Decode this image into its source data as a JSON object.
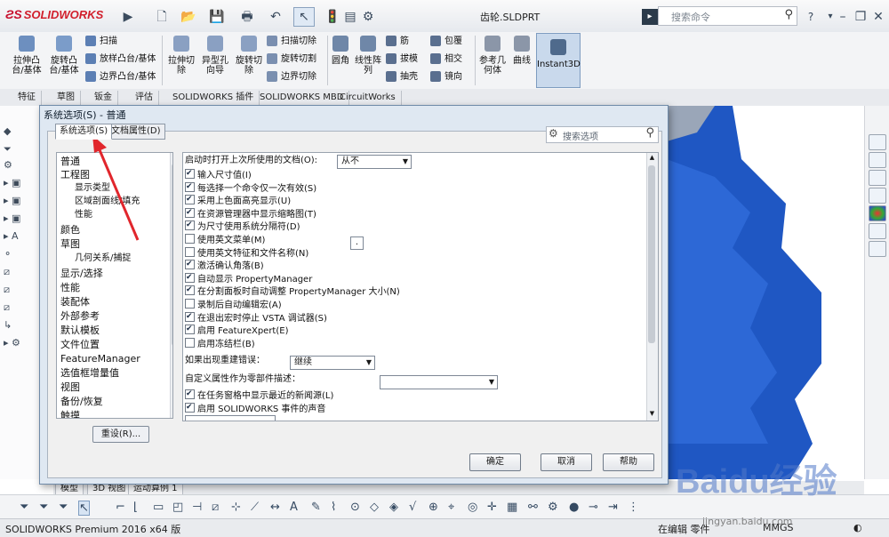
{
  "app": {
    "brand": "SOLIDWORKS",
    "file_title": "齿轮.SLDPRT",
    "search_placeholder": "搜索命令",
    "help_label": "?"
  },
  "ribbon": {
    "large": [
      "拉伸凸台/基体",
      "旋转凸台/基体",
      "拉伸切除",
      "异型孔向导",
      "旋转切除",
      "圆角",
      "线性阵列",
      "参考几何体",
      "曲线",
      "Instant3D"
    ],
    "small": [
      "扫描",
      "放样凸台/基体",
      "边界凸台/基体",
      "扫描切除",
      "旋转切割",
      "边界切除",
      "筋",
      "拔模",
      "抽壳",
      "包覆",
      "相交",
      "镜向"
    ]
  },
  "tabs": [
    "特征",
    "草图",
    "钣金",
    "评估",
    "SOLIDWORKS 插件",
    "SOLIDWORKS MBD",
    "CircuitWorks"
  ],
  "dialog": {
    "title": "系统选项(S) - 普通",
    "tab_system": "系统选项(S)",
    "tab_doc": "文档属性(D)",
    "search_placeholder": "搜索选项",
    "nav": [
      "普通",
      "工程图",
      "显示类型",
      "区域剖面线/填充",
      "性能",
      "颜色",
      "草图",
      "几何关系/捕捉",
      "显示/选择",
      "性能",
      "装配体",
      "外部参考",
      "默认模板",
      "文件位置",
      "FeatureManager",
      "选值框增量值",
      "视图",
      "备份/恢复",
      "触摸"
    ],
    "reset": "重设(R)...",
    "open_last_label": "启动时打开上次所使用的文档(O):",
    "open_last_value": "从不",
    "options": [
      {
        "label": "输入尺寸值(I)",
        "checked": true
      },
      {
        "label": "每选择一个命令仅一次有效(S)",
        "checked": true
      },
      {
        "label": "采用上色面高亮显示(U)",
        "checked": true
      },
      {
        "label": "在资源管理器中显示缩略图(T)",
        "checked": true
      },
      {
        "label": "为尺寸使用系统分隔符(D)",
        "checked": true
      },
      {
        "label": "使用英文菜单(M)",
        "checked": false
      },
      {
        "label": "使用英文特征和文件名称(N)",
        "checked": false
      },
      {
        "label": "激活确认角落(B)",
        "checked": true
      },
      {
        "label": "自动显示 PropertyManager",
        "checked": true
      },
      {
        "label": "在分割面板时自动调整 PropertyManager 大小(N)",
        "checked": true
      },
      {
        "label": "录制后自动编辑宏(A)",
        "checked": false
      },
      {
        "label": "在退出宏时停止 VSTA 调试器(S)",
        "checked": true
      },
      {
        "label": "启用 FeatureXpert(E)",
        "checked": true
      },
      {
        "label": "启用冻结栏(B)",
        "checked": false
      }
    ],
    "separator_value": ".",
    "rebuild_error_label": "如果出现重建错误：",
    "rebuild_error_value": "继续",
    "custom_prop_label": "自定义属性作为零部件描述：",
    "custom_prop_value": "",
    "options2": [
      {
        "label": "在任务窗格中显示最近的新闻源(L)",
        "checked": true
      },
      {
        "label": "启用 SOLIDWORKS 事件的声音",
        "checked": true
      }
    ],
    "ok": "确定",
    "cancel": "取消",
    "help": "帮助"
  },
  "bottom_tabs": [
    "模型",
    "3D 视图",
    "运动算例 1"
  ],
  "status": {
    "product": "SOLIDWORKS Premium 2016 x64 版",
    "mode": "在编辑 零件",
    "units": "MMGS"
  },
  "watermark": {
    "main": "Baidu经验",
    "sub": "jingyan.baidu.com"
  },
  "colors": {
    "accent": "#1f57c3",
    "dialog_bg": "#dfe8f2",
    "brand_red": "#c8102e",
    "arrow": "#e1262c"
  }
}
